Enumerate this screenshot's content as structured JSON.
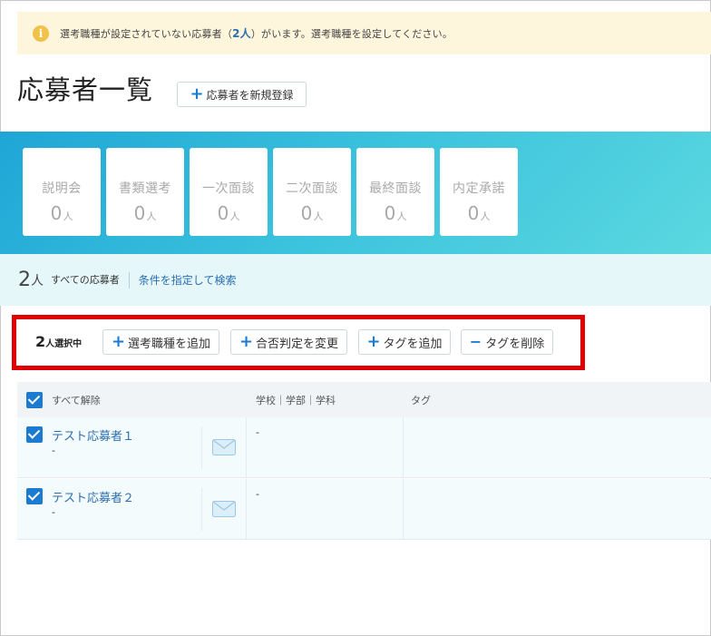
{
  "alert": {
    "text_before": "選考職種が設定されていない応募者（",
    "count": "2人",
    "text_after": "）がいます。選考職種を設定してください。",
    "icon": "info-icon"
  },
  "header": {
    "title": "応募者一覧",
    "add_button": "応募者を新規登録"
  },
  "stages": [
    {
      "name": "説明会",
      "count": "0",
      "unit": "人"
    },
    {
      "name": "書類選考",
      "count": "0",
      "unit": "人"
    },
    {
      "name": "一次面談",
      "count": "0",
      "unit": "人"
    },
    {
      "name": "二次面談",
      "count": "0",
      "unit": "人"
    },
    {
      "name": "最終面談",
      "count": "0",
      "unit": "人"
    },
    {
      "name": "内定承諾",
      "count": "0",
      "unit": "人"
    }
  ],
  "summary": {
    "count": "2",
    "unit": "人",
    "label": "すべての応募者",
    "search_link": "条件を指定して検索"
  },
  "actions": {
    "selected_count": "2",
    "selected_label": "人選択中",
    "add_job": "選考職種を追加",
    "change_result": "合否判定を変更",
    "add_tag": "タグを追加",
    "remove_tag": "タグを削除"
  },
  "table": {
    "deselect_all": "すべて解除",
    "col_school": "学校｜学部｜学科",
    "col_tag": "タグ",
    "rows": [
      {
        "name": "テスト応募者１",
        "sub": "-",
        "school": "-"
      },
      {
        "name": "テスト応募者２",
        "sub": "-",
        "school": "-"
      }
    ]
  },
  "colors": {
    "accent": "#1a7bd0",
    "highlight": "#e00000",
    "alert_bg": "#fdf5dc"
  }
}
